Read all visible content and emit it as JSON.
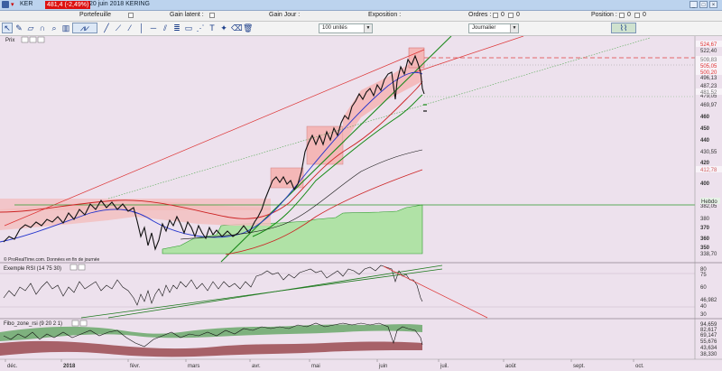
{
  "window": {
    "symbol": "KER",
    "price_badge": "481,4 (-2,49%)",
    "date_title": "20 juin 2018 KERING"
  },
  "info": {
    "portefeuille": "Portefeuille",
    "gain_latent": "Gain latent :",
    "gain_jour": "Gain Jour :",
    "exposition": "Exposition :",
    "ordres_label": "Ordres :",
    "ordres_a": "0",
    "ordres_b": "0",
    "position_label": "Position :",
    "position_a": "0",
    "position_b": "0"
  },
  "toolbar": {
    "quantity": "100 unités",
    "period": "Journalier"
  },
  "panels": {
    "price": {
      "title": "Prix",
      "credit": "© ProRealTime.com. Données en fin de journée",
      "y_ticks": [
        "522,40",
        "496,13",
        "487,23",
        "479,05",
        "469,97",
        "460",
        "450",
        "440",
        "430,55",
        "420",
        "400",
        "382,05",
        "380",
        "370",
        "360",
        "350",
        "338,70"
      ],
      "y_ticks_bold": [
        "460",
        "450",
        "440",
        "420",
        "400",
        "370",
        "360",
        "350"
      ],
      "y_badges": [
        {
          "text": "524,67",
          "color": "#e03030"
        },
        {
          "text": "509,83",
          "color": "#777777"
        },
        {
          "text": "505,05",
          "color": "#e03030"
        },
        {
          "text": "500,20",
          "color": "#e03030"
        },
        {
          "text": "481,52",
          "color": "#777777"
        },
        {
          "text": "412,78",
          "color": "#d06060"
        }
      ],
      "hebdo_label": "Hebdo"
    },
    "rsi": {
      "title": "Exemple RSI (14 75 30)",
      "y_ticks": [
        "80",
        "75",
        "60",
        "46,982",
        "40",
        "30"
      ]
    },
    "fibo": {
      "title": "Fibo_zone_rsi (9 20 2 1)",
      "y_ticks": [
        "94,659",
        "82,617",
        "69,147",
        "55,676",
        "43,634",
        "38,330"
      ]
    }
  },
  "x_axis": {
    "labels": [
      "déc.",
      "2018",
      "févr.",
      "mars",
      "avr.",
      "mai",
      "juin",
      "juil.",
      "août",
      "sept.",
      "oct."
    ],
    "bold": [
      "2018"
    ]
  },
  "colors": {
    "price_line": "#111111",
    "ma_blue": "#2233cc",
    "ma_red": "#cc2222",
    "ma_green": "#118811",
    "cloud_green": "#aee6a6",
    "band_pink": "#f4b7b7",
    "price_badge_bg": "#dd1111"
  }
}
